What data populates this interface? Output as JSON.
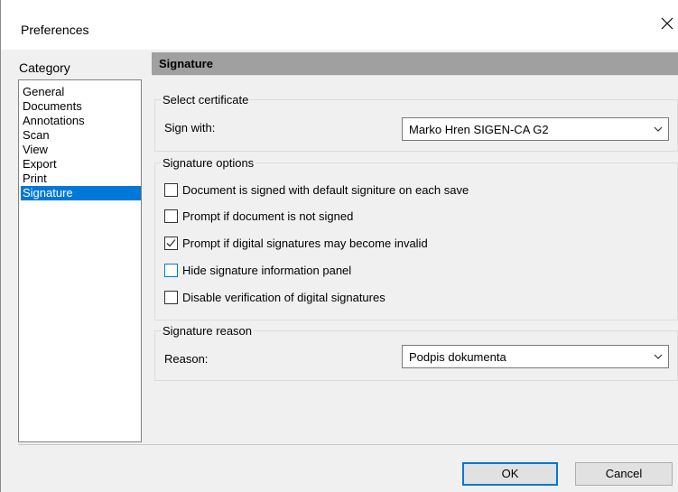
{
  "window": {
    "title": "Preferences"
  },
  "category": {
    "label": "Category",
    "items": [
      {
        "label": "General"
      },
      {
        "label": "Documents"
      },
      {
        "label": "Annotations"
      },
      {
        "label": "Scan"
      },
      {
        "label": "View"
      },
      {
        "label": "Export"
      },
      {
        "label": "Print"
      },
      {
        "label": "Signature",
        "selected": true
      }
    ]
  },
  "panel": {
    "title": "Signature",
    "select_certificate": {
      "legend": "Select certificate",
      "sign_with_label": "Sign with:",
      "sign_with_value": "Marko Hren SIGEN-CA G2"
    },
    "signature_options": {
      "legend": "Signature options",
      "options": [
        {
          "label": "Document is signed with default signiture on each save",
          "checked": false
        },
        {
          "label": "Prompt if document is not signed",
          "checked": false
        },
        {
          "label": "Prompt if digital signatures may become invalid",
          "checked": true
        },
        {
          "label": "Hide signature information panel",
          "checked": false,
          "focused": true
        },
        {
          "label": "Disable verification of digital signatures",
          "checked": false
        }
      ]
    },
    "signature_reason": {
      "legend": "Signature reason",
      "reason_label": "Reason:",
      "reason_value": "Podpis dokumenta"
    }
  },
  "buttons": {
    "ok": "OK",
    "cancel": "Cancel"
  },
  "colors": {
    "selection": "#0078d7",
    "header_bar": "#a0a0a0",
    "focus": "#0078d7"
  },
  "icons": {
    "close": "close-icon",
    "dropdown": "chevron-down-icon",
    "check": "checkmark-icon"
  }
}
